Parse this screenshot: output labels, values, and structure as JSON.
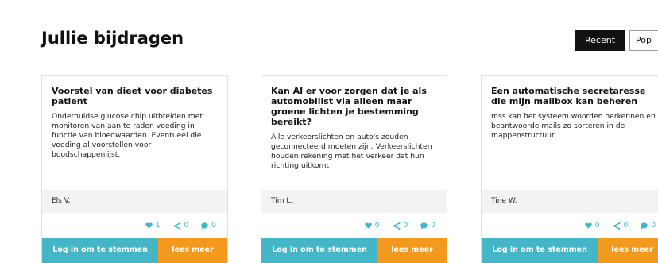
{
  "header": {
    "title": "Jullie bijdragen"
  },
  "sort": {
    "recent_label": "Recent",
    "popular_label": "Pop"
  },
  "colors": {
    "vote_button": "#45b6c8",
    "more_button": "#f39a1e",
    "stat_icons": "#3db7c9",
    "active_sort": "#111111"
  },
  "cards": [
    {
      "title": "Voorstel van dieet voor diabetes patient",
      "text": "Onderhuidse glucose chip uitbreiden met monitoren van aan te raden voeding in functie van bloedwaarden. Eventueel die voeding al voorstellen voor boodschappenlijst.",
      "author": "Els V.",
      "likes": "1",
      "shares": "0",
      "comments": "0",
      "vote_label": "Log in om te stemmen",
      "more_label": "lees meer"
    },
    {
      "title": "Kan AI er voor zorgen dat je als automobilist via alleen maar groene lichten je bestemming bereikt?",
      "text": "Alle verkeerslichten en auto's zouden geconnecteerd moeten zijn. Verkeerslichten houden rekening met het verkeer dat hun richting uitkomt",
      "author": "Tim L.",
      "likes": "0",
      "shares": "0",
      "comments": "0",
      "vote_label": "Log in om te stemmen",
      "more_label": "lees meer"
    },
    {
      "title": "Een automatische secretaresse die mijn mailbox kan beheren",
      "text": "mss kan het systeem woorden herkennen en beantwoorde mails zo sorteren in de mappenstructuur",
      "author": "Tine W.",
      "likes": "0",
      "shares": "0",
      "comments": "0",
      "vote_label": "Log in om te stemmen",
      "more_label": "lees meer"
    }
  ],
  "icons": {
    "like": "heart-icon",
    "share": "share-icon",
    "comment": "comment-icon"
  }
}
